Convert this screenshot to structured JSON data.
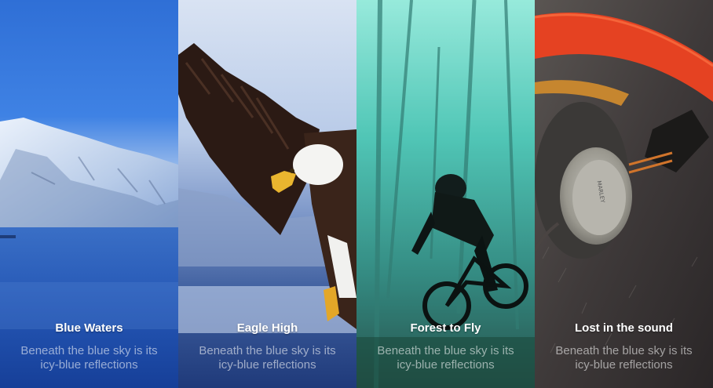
{
  "panels": [
    {
      "title": "Blue Waters",
      "description": "Beneath the blue sky is its icy-blue reflections",
      "image": "snowy-mountain-lake"
    },
    {
      "title": "Eagle High",
      "description": "Beneath the blue sky is its icy-blue reflections",
      "image": "bald-eagle-flying"
    },
    {
      "title": "Forest to Fly",
      "description": "Beneath the blue sky is its icy-blue reflections",
      "image": "mountain-biker-forest"
    },
    {
      "title": "Lost in the sound",
      "description": "Beneath the blue sky is its icy-blue reflections",
      "image": "headphones-on-fur",
      "brand_text": "MARLEY"
    }
  ]
}
